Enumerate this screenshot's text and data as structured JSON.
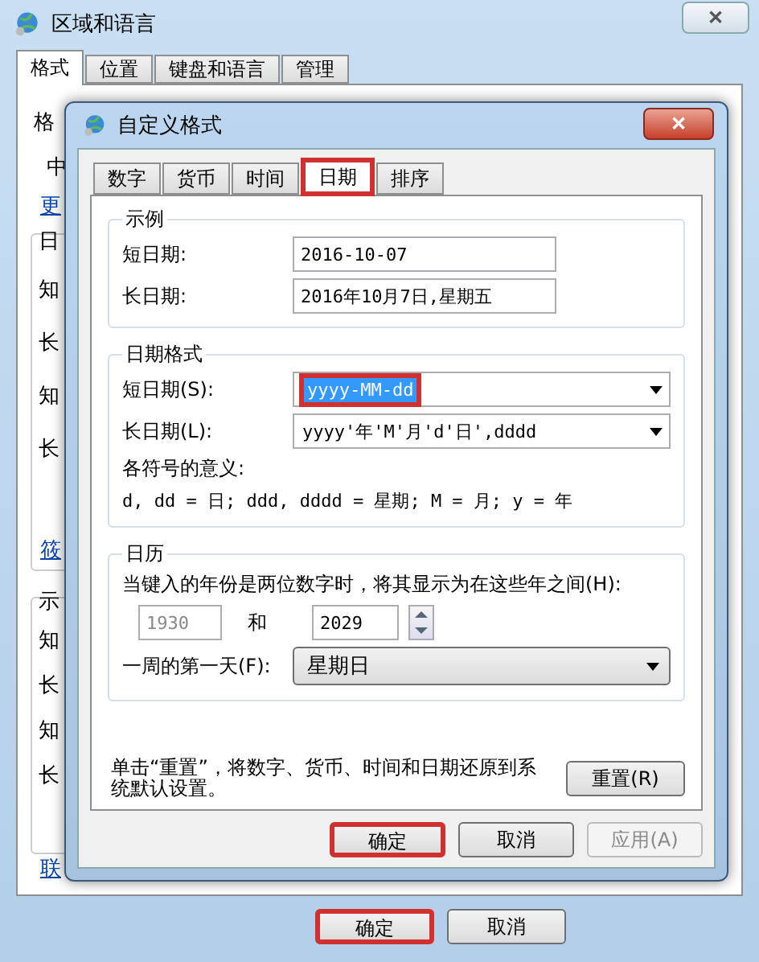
{
  "window": {
    "title": "区域和语言",
    "close": "✕"
  },
  "tabs": [
    {
      "label": "格式",
      "selected": true
    },
    {
      "label": "位置",
      "selected": false
    },
    {
      "label": "键盘和语言",
      "selected": false
    },
    {
      "label": "管理",
      "selected": false
    }
  ],
  "background_fragments": {
    "format_label": "格",
    "format_combo": "中",
    "link_top": "更",
    "group_1": {
      "label": "日",
      "rows": [
        "知",
        "长",
        "知",
        "长"
      ],
      "link": "筱"
    },
    "group_2": {
      "label": "示",
      "rows": [
        "知",
        "长",
        "知",
        "长"
      ]
    },
    "link_bottom": "联"
  },
  "buttons": [
    {
      "label": "确定",
      "highlighted": true
    },
    {
      "label": "取消",
      "highlighted": false
    }
  ],
  "dialog": {
    "title": "自定义格式",
    "close": "✕",
    "tabs": [
      {
        "label": "数字",
        "selected": false,
        "highlighted": false
      },
      {
        "label": "货币",
        "selected": false,
        "highlighted": false
      },
      {
        "label": "时间",
        "selected": false,
        "highlighted": false
      },
      {
        "label": "日期",
        "selected": true,
        "highlighted": true
      },
      {
        "label": "排序",
        "selected": false,
        "highlighted": false
      }
    ],
    "example": {
      "title": "示例",
      "rows": [
        {
          "label": "短日期:",
          "value": "2016-10-07"
        },
        {
          "label": "长日期:",
          "value": "2016年10月7日,星期五"
        }
      ]
    },
    "date_formats": {
      "title": "日期格式",
      "rows": [
        {
          "label": "短日期(S):",
          "value": "yyyy-MM-dd",
          "selected": true,
          "highlighted": true
        },
        {
          "label": "长日期(L):",
          "value": "yyyy'年'M'月'd'日',dddd",
          "selected": false,
          "highlighted": false
        }
      ],
      "legend_title": "各符号的意义:",
      "legend": "d, dd = 日;  ddd, dddd = 星期;  M = 月;  y = 年"
    },
    "calendar": {
      "title": "日历",
      "range_label": "当键入的年份是两位数字时，将其显示为在这些年之间(H):",
      "from": "1930",
      "and": "和",
      "to": "2029",
      "first_day_label": "一周的第一天(F):",
      "first_day": "星期日"
    },
    "reset_text": "单击“重置”，将数字、货币、时间和日期还原到系统默认设置。",
    "reset_button": "重置(R)",
    "buttons": [
      {
        "label": "确定",
        "highlighted": true,
        "disabled": false
      },
      {
        "label": "取消",
        "highlighted": false,
        "disabled": false
      },
      {
        "label": "应用(A)",
        "highlighted": false,
        "disabled": true
      }
    ]
  }
}
